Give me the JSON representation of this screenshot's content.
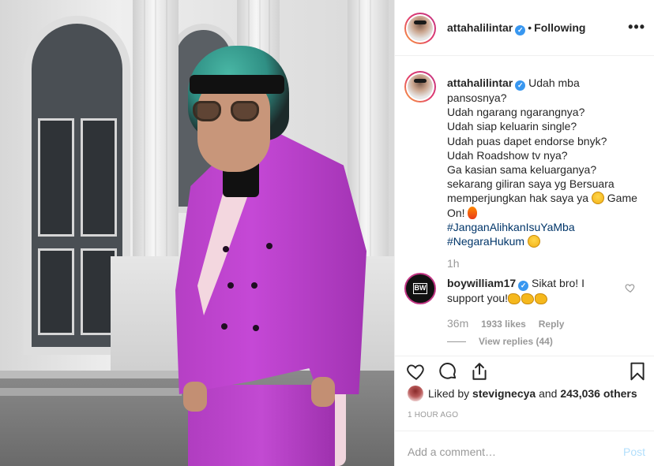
{
  "header": {
    "username": "attahalilintar",
    "follow_status": "Following",
    "more_label": "•••"
  },
  "caption": {
    "username": "attahalilintar",
    "lines": [
      "Udah mba",
      "pansosnya?",
      "Udah ngarang ngarangnya?",
      "Udah siap keluarin single?",
      "Udah puas dapet endorse bnyk?",
      "Udah Roadshow tv nya?",
      "Ga kasian sama keluarganya?",
      "sekarang giliran saya yg Bersuara",
      "memperjungkan hak saya ya",
      "Game",
      "On!"
    ],
    "hashtags": [
      "#JanganAlihkanIsuYaMba",
      "#NegaraHukum"
    ],
    "time": "1h"
  },
  "comment": {
    "username": "boywilliam17",
    "text_1": "Sikat bro! I",
    "text_2": "support you!",
    "time": "36m",
    "likes": "1933 likes",
    "reply_label": "Reply",
    "view_replies": "View replies (44)",
    "avatar_logo": "BW"
  },
  "likes": {
    "prefix": "Liked by",
    "liker": "stevignecya",
    "connector": "and",
    "count": "243,036 others"
  },
  "posted_time": "1 HOUR AGO",
  "add_comment": {
    "placeholder": "Add a comment…",
    "post_label": "Post"
  },
  "icons": {
    "verified": "verified-badge-icon",
    "like": "heart-icon",
    "comment": "comment-bubble-icon",
    "share": "share-icon",
    "save": "bookmark-icon"
  },
  "colors": {
    "verified": "#3897f0",
    "hashtag": "#003569",
    "muted": "#999999",
    "post_disabled": "#b2dffc"
  }
}
